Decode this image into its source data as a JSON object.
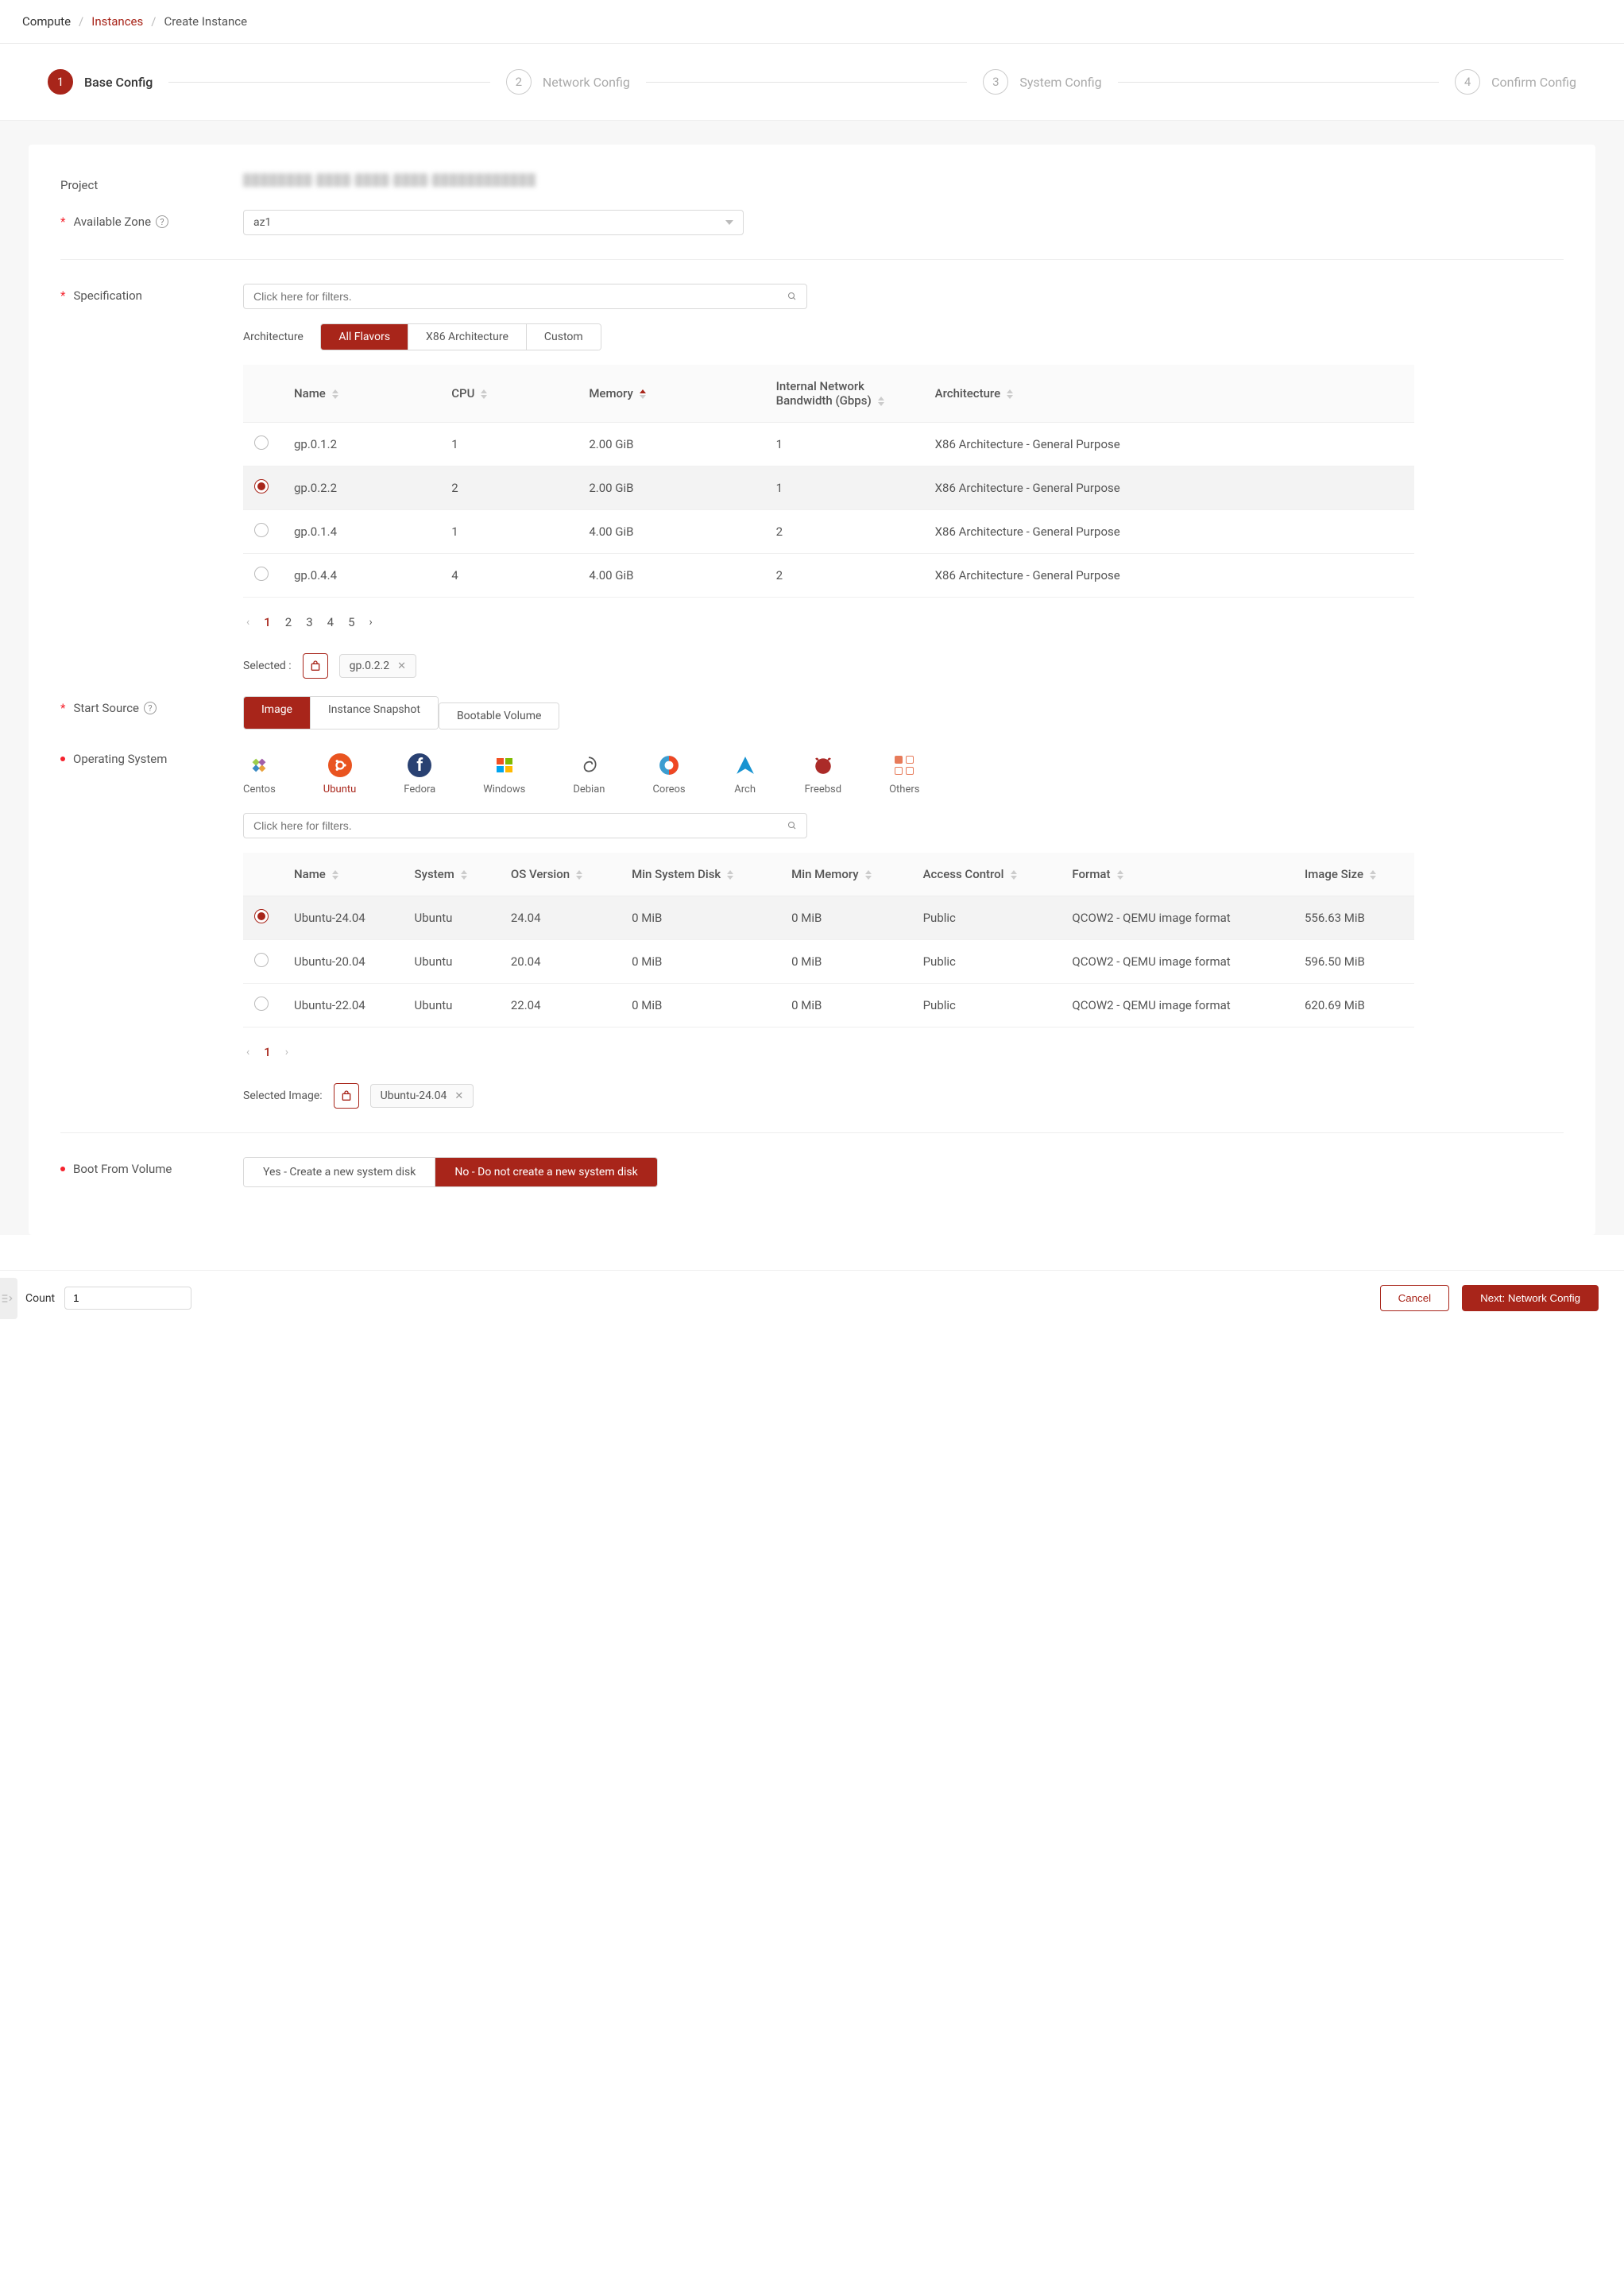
{
  "breadcrumb": {
    "l1": "Compute",
    "l2": "Instances",
    "l3": "Create Instance"
  },
  "steps": [
    {
      "num": "1",
      "label": "Base Config"
    },
    {
      "num": "2",
      "label": "Network Config"
    },
    {
      "num": "3",
      "label": "System Config"
    },
    {
      "num": "4",
      "label": "Confirm Config"
    }
  ],
  "labels": {
    "project": "Project",
    "available_zone": "Available Zone",
    "specification": "Specification",
    "architecture": "Architecture",
    "start_source": "Start Source",
    "operating_system": "Operating System",
    "boot": "Boot From Volume",
    "selected_colon": "Selected :",
    "selected_image": "Selected Image:",
    "count": "Count"
  },
  "project_value": "████████-████-████-████-████████████",
  "available_zone_value": "az1",
  "spec_filter_placeholder": "Click here for filters.",
  "arch_tabs": {
    "all": "All Flavors",
    "x86": "X86 Architecture",
    "custom": "Custom"
  },
  "spec_columns": {
    "name": "Name",
    "cpu": "CPU",
    "memory": "Memory",
    "bandwidth": "Internal Network Bandwidth (Gbps)",
    "architecture": "Architecture"
  },
  "spec_rows": [
    {
      "name": "gp.0.1.2",
      "cpu": "1",
      "mem": "2.00 GiB",
      "bw": "1",
      "arch": "X86 Architecture - General Purpose"
    },
    {
      "name": "gp.0.2.2",
      "cpu": "2",
      "mem": "2.00 GiB",
      "bw": "1",
      "arch": "X86 Architecture - General Purpose"
    },
    {
      "name": "gp.0.1.4",
      "cpu": "1",
      "mem": "4.00 GiB",
      "bw": "2",
      "arch": "X86 Architecture - General Purpose"
    },
    {
      "name": "gp.0.4.4",
      "cpu": "4",
      "mem": "4.00 GiB",
      "bw": "2",
      "arch": "X86 Architecture - General Purpose"
    }
  ],
  "spec_pages": [
    "1",
    "2",
    "3",
    "4",
    "5"
  ],
  "selected_spec": "gp.0.2.2",
  "start_source_tabs": {
    "image": "Image",
    "snapshot": "Instance Snapshot",
    "bootable": "Bootable Volume"
  },
  "os_options": [
    {
      "label": "Centos"
    },
    {
      "label": "Ubuntu"
    },
    {
      "label": "Fedora"
    },
    {
      "label": "Windows"
    },
    {
      "label": "Debian"
    },
    {
      "label": "Coreos"
    },
    {
      "label": "Arch"
    },
    {
      "label": "Freebsd"
    },
    {
      "label": "Others"
    }
  ],
  "image_filter_placeholder": "Click here for filters.",
  "image_columns": {
    "name": "Name",
    "system": "System",
    "os_ver": "OS Version",
    "min_disk": "Min System Disk",
    "min_mem": "Min Memory",
    "access": "Access Control",
    "format": "Format",
    "img_size": "Image Size"
  },
  "image_rows": [
    {
      "name": "Ubuntu-24.04",
      "system": "Ubuntu",
      "ver": "24.04",
      "disk": "0 MiB",
      "mem": "0 MiB",
      "access": "Public",
      "format": "QCOW2 - QEMU image format",
      "size": "556.63 MiB"
    },
    {
      "name": "Ubuntu-20.04",
      "system": "Ubuntu",
      "ver": "20.04",
      "disk": "0 MiB",
      "mem": "0 MiB",
      "access": "Public",
      "format": "QCOW2 - QEMU image format",
      "size": "596.50 MiB"
    },
    {
      "name": "Ubuntu-22.04",
      "system": "Ubuntu",
      "ver": "22.04",
      "disk": "0 MiB",
      "mem": "0 MiB",
      "access": "Public",
      "format": "QCOW2 - QEMU image format",
      "size": "620.69 MiB"
    }
  ],
  "image_pages": [
    "1"
  ],
  "selected_image": "Ubuntu-24.04",
  "boot_tabs": {
    "yes": "Yes - Create a new system disk",
    "no": "No - Do not create a new system disk"
  },
  "count_value": "1",
  "footer": {
    "cancel": "Cancel",
    "next": "Next: Network Config"
  }
}
